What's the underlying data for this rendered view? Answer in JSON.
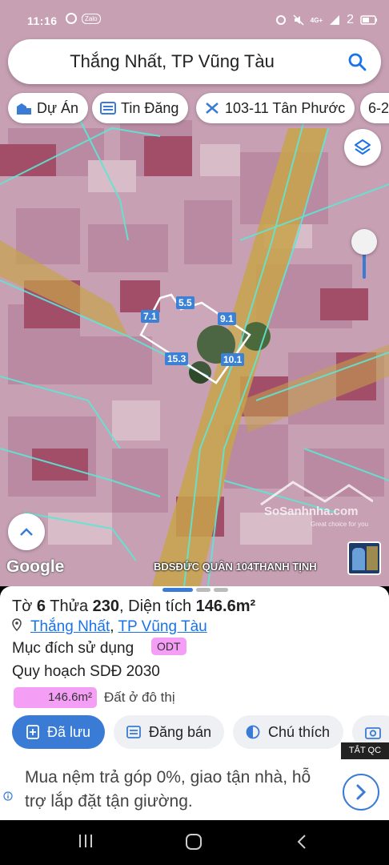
{
  "status": {
    "time": "11:16",
    "sim_label": "2",
    "network": "4G+"
  },
  "search": {
    "query": "Thắng Nhất, TP Vũng Tàu"
  },
  "chips": [
    {
      "label": "Dự Án",
      "icon": "building-icon"
    },
    {
      "label": "Tin Đăng",
      "icon": "list-icon"
    },
    {
      "label": "103-11 Tân Phước",
      "icon": "route-icon"
    },
    {
      "label": "6-2",
      "icon": ""
    }
  ],
  "map": {
    "plot_dimensions": [
      "5.5",
      "7.1",
      "9.1",
      "15.3",
      "10.1"
    ],
    "google_label": "Google",
    "watermark": {
      "brand": "SoSanhnha.com",
      "tagline": "Great choice for you"
    },
    "credit": "BDSĐỨC QUÂN 104THANH TỊNH"
  },
  "sheet": {
    "title_prefix": "Tờ",
    "sheet_no": "6",
    "parcel_prefix": "Thửa",
    "parcel_no": "230",
    "area_prefix": ", Diện tích",
    "area_value": "146.6m²",
    "loc_ward": "Thắng Nhất",
    "loc_city": "TP Vũng Tàu",
    "purpose_label": "Mục đích sử dụng",
    "purpose_code": "ODT",
    "plan_label": "Quy hoạch SDĐ 2030",
    "plan_area": "146.6m²",
    "plan_type": "Đất ở đô thị",
    "buttons": {
      "saved": "Đã lưu",
      "post_sale": "Đăng bán",
      "note": "Chú thích"
    }
  },
  "ad": {
    "close_label": "TẮT QC",
    "text": "Mua nệm trả góp 0%, giao tận nhà, hỗ trợ lắp đặt tận giường."
  },
  "colors": {
    "accent": "#3a7bd5",
    "odt_pink": "#f59ef5",
    "boundary_cyan": "#5fe6d3"
  }
}
